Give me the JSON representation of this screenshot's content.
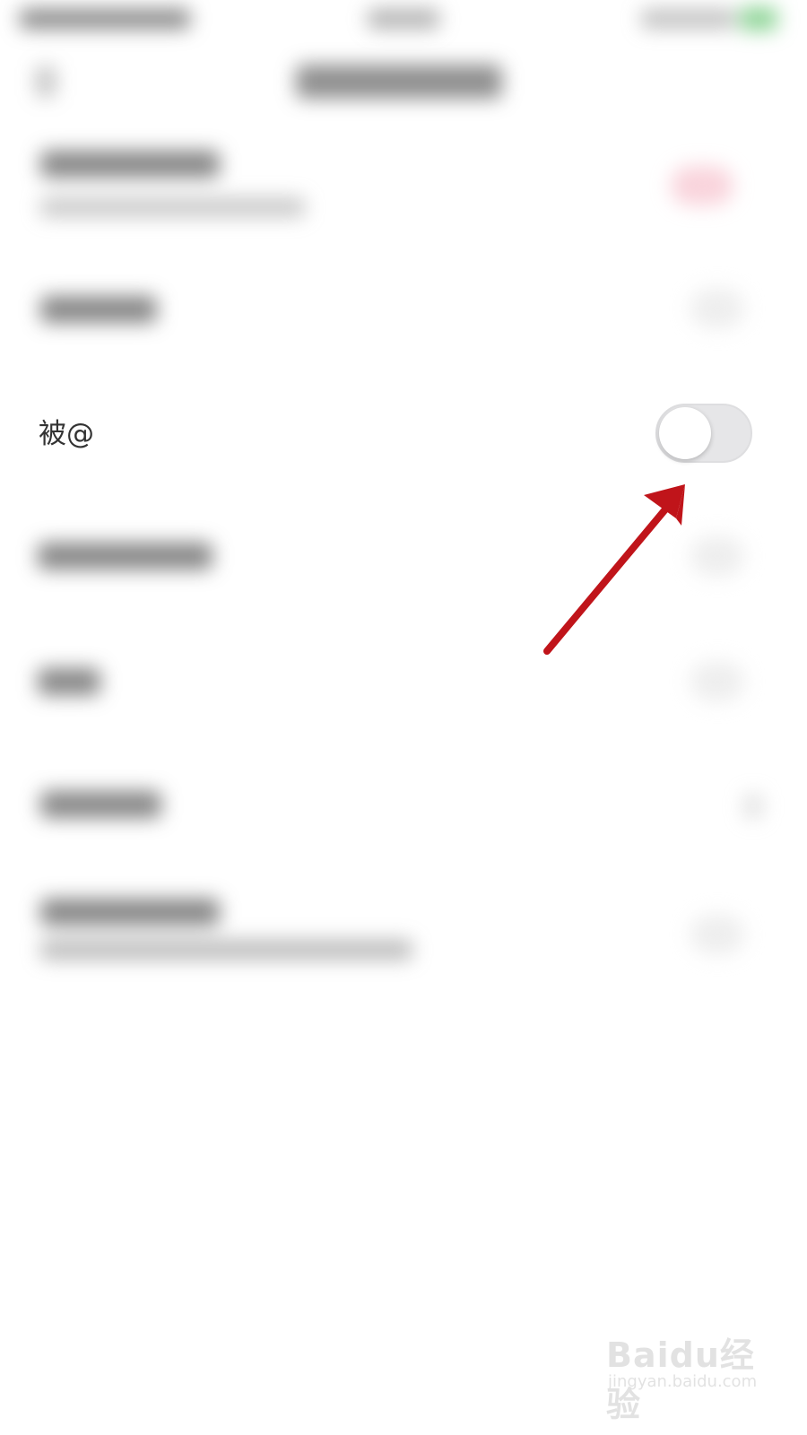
{
  "settings": {
    "visible_row": {
      "label": "被@",
      "toggle_state": "off"
    }
  },
  "colors": {
    "toggle_track_off": "#e6e6e8",
    "toggle_knob": "#ffffff",
    "annotation_arrow": "#c0141a",
    "label_text": "#333333"
  },
  "icons": {
    "annotation": "red-arrow-icon"
  },
  "watermark": {
    "brand": "Baidu经验",
    "site": "jingyan.baidu.com"
  }
}
